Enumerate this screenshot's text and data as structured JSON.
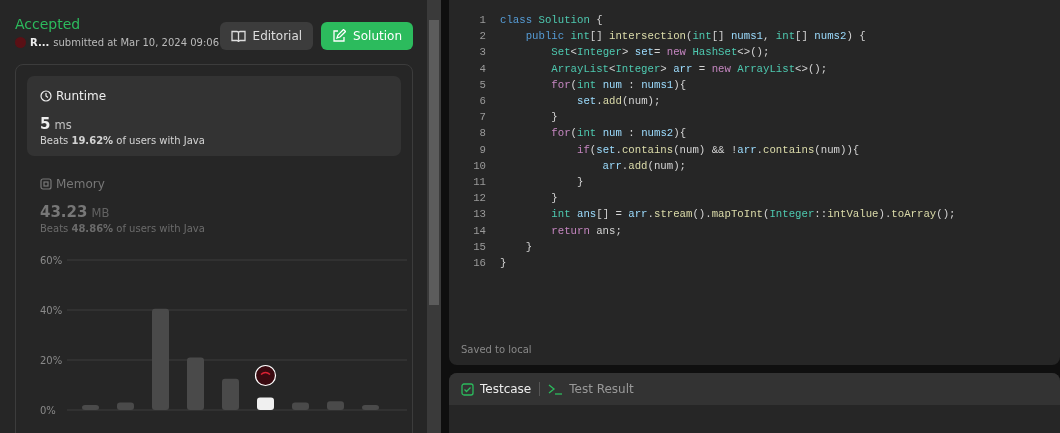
{
  "submission": {
    "status": "Accepted",
    "author": "R...",
    "submitted_text": "submitted at Mar 10, 2024 09:06"
  },
  "header_buttons": [
    {
      "kind": "editorial",
      "label": "Editorial"
    },
    {
      "kind": "solution",
      "label": "Solution"
    }
  ],
  "metrics": [
    {
      "kind": "runtime",
      "title": "Runtime",
      "selected": true,
      "value": "5",
      "unit": "ms",
      "beats_text": "Beats **19.62%** of users with Java"
    },
    {
      "kind": "memory",
      "title": "Memory",
      "selected": false,
      "value": "43.23",
      "unit": "MB",
      "beats_text": "Beats **48.86%** of users with Java"
    }
  ],
  "chart_data": {
    "type": "bar",
    "grid": true,
    "ylim": [
      0,
      60
    ],
    "yticks": [
      {
        "value": 0,
        "label": "0%"
      },
      {
        "value": 20,
        "label": "20%"
      },
      {
        "value": 40,
        "label": "40%"
      },
      {
        "value": 60,
        "label": "60%"
      }
    ],
    "series": [
      {
        "color": "#4a4a4a",
        "values": [
          2,
          3,
          40.5,
          21,
          12.5,
          null,
          3,
          3.5,
          2
        ]
      },
      {
        "color": "#f0f0f0",
        "values": [
          null,
          null,
          null,
          null,
          null,
          5,
          null,
          null,
          null
        ]
      }
    ]
  },
  "editor": {
    "lines": [
      [
        {
          "kind": "keyword",
          "text": "class"
        },
        {
          "kind": "type",
          "text": " Solution"
        },
        {
          "kind": "plain",
          "text": " {"
        }
      ],
      [
        {
          "kind": "keyword",
          "text": "    public"
        },
        {
          "kind": "type",
          "text": " int"
        },
        {
          "kind": "plain",
          "text": "[] "
        },
        {
          "kind": "func",
          "text": "intersection"
        },
        {
          "kind": "plain",
          "text": "("
        },
        {
          "kind": "type",
          "text": "int"
        },
        {
          "kind": "plain",
          "text": "[] "
        },
        {
          "kind": "var",
          "text": "nums1"
        },
        {
          "kind": "plain",
          "text": ", "
        },
        {
          "kind": "type",
          "text": "int"
        },
        {
          "kind": "plain",
          "text": "[] "
        },
        {
          "kind": "var",
          "text": "nums2"
        },
        {
          "kind": "plain",
          "text": ") {"
        }
      ],
      [
        {
          "kind": "type",
          "text": "        Set"
        },
        {
          "kind": "plain",
          "text": "<"
        },
        {
          "kind": "type",
          "text": "Integer"
        },
        {
          "kind": "plain",
          "text": "> "
        },
        {
          "kind": "var",
          "text": "set"
        },
        {
          "kind": "plain",
          "text": "= "
        },
        {
          "kind": "control",
          "text": "new"
        },
        {
          "kind": "type",
          "text": " HashSet"
        },
        {
          "kind": "plain",
          "text": "<>();"
        }
      ],
      [
        {
          "kind": "type",
          "text": "        ArrayList"
        },
        {
          "kind": "plain",
          "text": "<"
        },
        {
          "kind": "type",
          "text": "Integer"
        },
        {
          "kind": "plain",
          "text": "> "
        },
        {
          "kind": "var",
          "text": "arr"
        },
        {
          "kind": "plain",
          "text": " = "
        },
        {
          "kind": "control",
          "text": "new"
        },
        {
          "kind": "type",
          "text": " ArrayList"
        },
        {
          "kind": "plain",
          "text": "<>();"
        }
      ],
      [
        {
          "kind": "control",
          "text": "        for"
        },
        {
          "kind": "plain",
          "text": "("
        },
        {
          "kind": "type",
          "text": "int"
        },
        {
          "kind": "var",
          "text": " num"
        },
        {
          "kind": "plain",
          "text": " : "
        },
        {
          "kind": "var",
          "text": "nums1"
        },
        {
          "kind": "plain",
          "text": "){"
        }
      ],
      [
        {
          "kind": "var",
          "text": "            set"
        },
        {
          "kind": "plain",
          "text": "."
        },
        {
          "kind": "func",
          "text": "add"
        },
        {
          "kind": "plain",
          "text": "(num);"
        }
      ],
      [
        {
          "kind": "plain",
          "text": "        }"
        }
      ],
      [
        {
          "kind": "control",
          "text": "        for"
        },
        {
          "kind": "plain",
          "text": "("
        },
        {
          "kind": "type",
          "text": "int"
        },
        {
          "kind": "var",
          "text": " num"
        },
        {
          "kind": "plain",
          "text": " : "
        },
        {
          "kind": "var",
          "text": "nums2"
        },
        {
          "kind": "plain",
          "text": "){"
        }
      ],
      [
        {
          "kind": "control",
          "text": "            if"
        },
        {
          "kind": "plain",
          "text": "("
        },
        {
          "kind": "var",
          "text": "set"
        },
        {
          "kind": "plain",
          "text": "."
        },
        {
          "kind": "func",
          "text": "contains"
        },
        {
          "kind": "plain",
          "text": "(num) && !"
        },
        {
          "kind": "var",
          "text": "arr"
        },
        {
          "kind": "plain",
          "text": "."
        },
        {
          "kind": "func",
          "text": "contains"
        },
        {
          "kind": "plain",
          "text": "(num)){"
        }
      ],
      [
        {
          "kind": "var",
          "text": "                arr"
        },
        {
          "kind": "plain",
          "text": "."
        },
        {
          "kind": "func",
          "text": "add"
        },
        {
          "kind": "plain",
          "text": "(num);"
        }
      ],
      [
        {
          "kind": "plain",
          "text": "            }"
        }
      ],
      [
        {
          "kind": "plain",
          "text": "        }"
        }
      ],
      [
        {
          "kind": "type",
          "text": "        int"
        },
        {
          "kind": "var",
          "text": " ans"
        },
        {
          "kind": "plain",
          "text": "[] = "
        },
        {
          "kind": "var",
          "text": "arr"
        },
        {
          "kind": "plain",
          "text": "."
        },
        {
          "kind": "func",
          "text": "stream"
        },
        {
          "kind": "plain",
          "text": "()."
        },
        {
          "kind": "func",
          "text": "mapToInt"
        },
        {
          "kind": "plain",
          "text": "("
        },
        {
          "kind": "type",
          "text": "Integer"
        },
        {
          "kind": "plain",
          "text": "::"
        },
        {
          "kind": "func",
          "text": "intValue"
        },
        {
          "kind": "plain",
          "text": ")."
        },
        {
          "kind": "func",
          "text": "toArray"
        },
        {
          "kind": "plain",
          "text": "();"
        }
      ],
      [
        {
          "kind": "control",
          "text": "        return"
        },
        {
          "kind": "plain",
          "text": " ans;"
        }
      ],
      [
        {
          "kind": "plain",
          "text": "    }"
        }
      ],
      [
        {
          "kind": "plain",
          "text": "}"
        }
      ]
    ],
    "line_numbers": [
      "1",
      "2",
      "3",
      "4",
      "5",
      "6",
      "7",
      "8",
      "9",
      "10",
      "11",
      "12",
      "13",
      "14",
      "15",
      "16"
    ],
    "status": "Saved to local"
  },
  "bottom_tabs": [
    {
      "kind": "testcase",
      "label": "Testcase",
      "selected": true
    },
    {
      "kind": "result",
      "label": "Test Result",
      "selected": false
    }
  ]
}
